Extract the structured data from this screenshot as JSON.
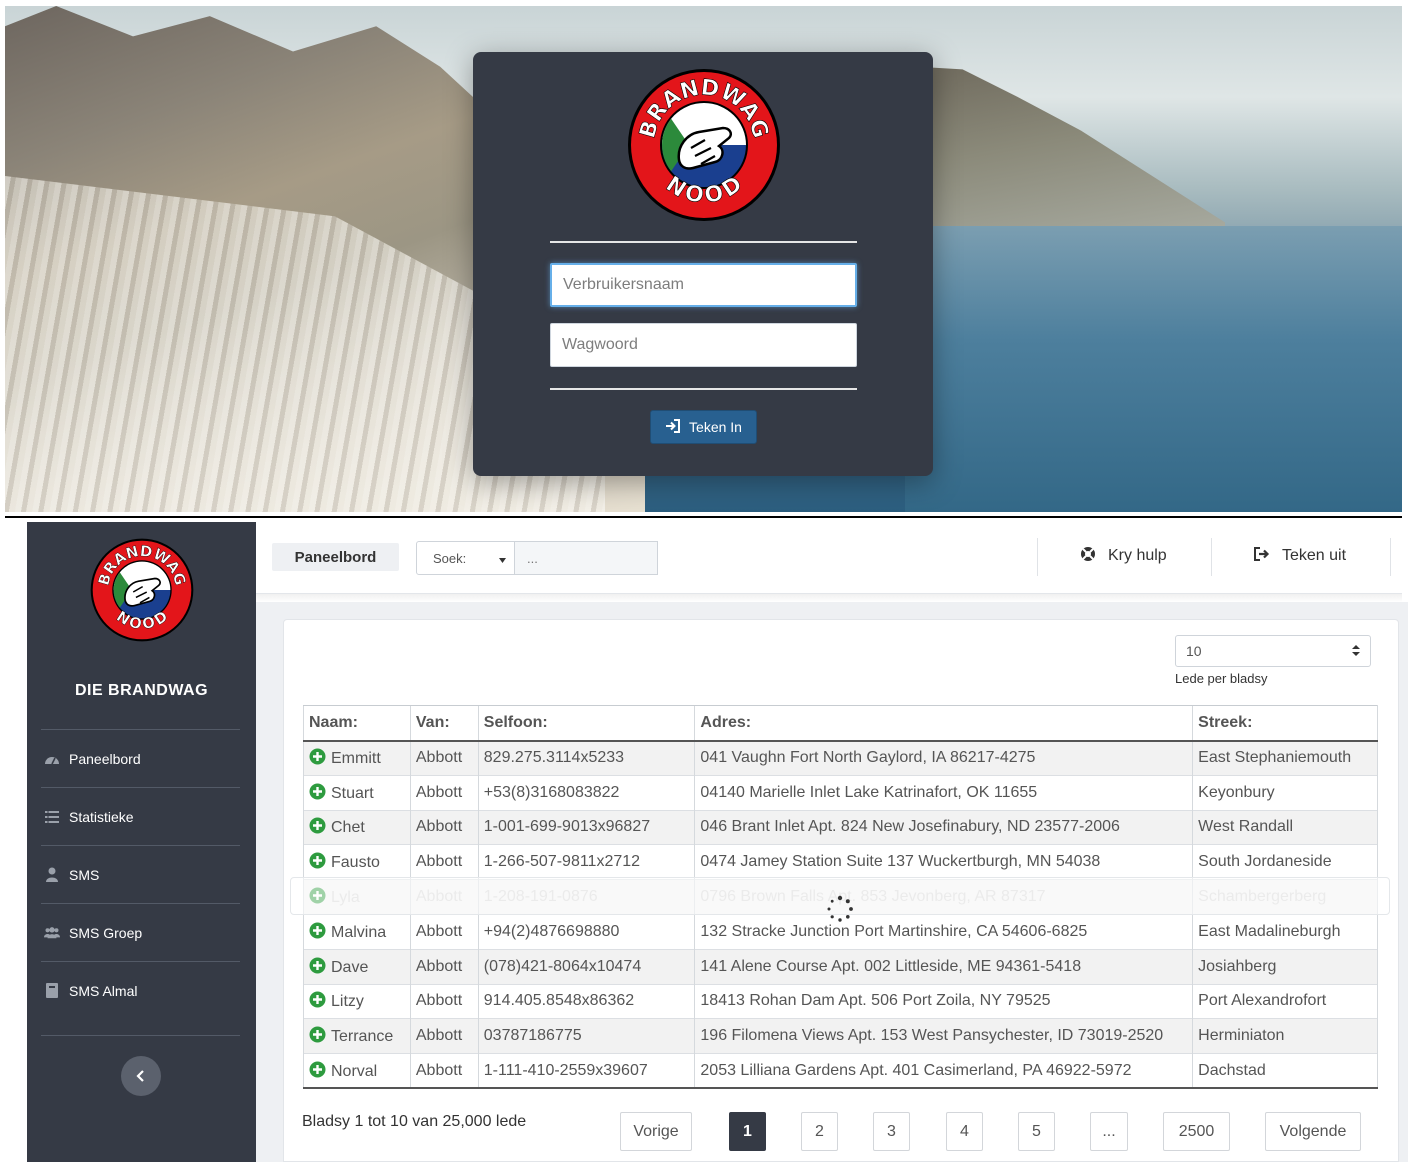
{
  "login": {
    "logo_top_text": "BRANDWAG",
    "logo_bottom_text": "NOOD",
    "username_placeholder": "Verbruikersnaam",
    "password_placeholder": "Wagwoord",
    "submit_label": "Teken In"
  },
  "sidebar": {
    "logo_top_text": "BRANDWAG",
    "logo_bottom_text": "NOOD",
    "title": "DIE BRANDWAG",
    "items": [
      {
        "label": "Paneelbord",
        "icon": "dashboard-icon"
      },
      {
        "label": "Statistieke",
        "icon": "list-icon"
      },
      {
        "label": "SMS",
        "icon": "user-icon"
      },
      {
        "label": "SMS Groep",
        "icon": "users-icon"
      },
      {
        "label": "SMS Almal",
        "icon": "book-icon"
      }
    ],
    "collapse_icon": "chevron-left-icon"
  },
  "topbar": {
    "breadcrumb": "Paneelbord",
    "search_select": "Soek:",
    "search_placeholder": "...",
    "help_label": "Kry hulp",
    "logout_label": "Teken uit"
  },
  "table_controls": {
    "page_size": "10",
    "page_size_label": "Lede per bladsy"
  },
  "table": {
    "headers": [
      "Naam:",
      "Van:",
      "Selfoon:",
      "Adres:",
      "Streek:"
    ],
    "rows": [
      [
        "Emmitt",
        "Abbott",
        "829.275.3114x5233",
        "041 Vaughn Fort North Gaylord, IA 86217-4275",
        "East Stephaniemouth"
      ],
      [
        "Stuart",
        "Abbott",
        "+53(8)3168083822",
        "04140 Marielle Inlet Lake Katrinafort, OK 11655",
        "Keyonbury"
      ],
      [
        "Chet",
        "Abbott",
        "1-001-699-9013x96827",
        "046 Brant Inlet Apt. 824 New Josefinabury, ND 23577-2006",
        "West Randall"
      ],
      [
        "Fausto",
        "Abbott",
        "1-266-507-9811x2712",
        "0474 Jamey Station Suite 137 Wuckertburgh, MN 54038",
        "South Jordaneside"
      ],
      [
        "Lyla",
        "Abbott",
        "1-208-191-0876",
        "0796 Brown Falls Apt. 853 Jevonberg, AR 87317",
        "Schambergerberg"
      ],
      [
        "Malvina",
        "Abbott",
        "+94(2)4876698880",
        "132 Stracke Junction Port Martinshire, CA 54606-6825",
        "East Madalineburgh"
      ],
      [
        "Dave",
        "Abbott",
        "(078)421-8064x10474",
        "141 Alene Course Apt. 002 Littleside, ME 94361-5418",
        "Josiahberg"
      ],
      [
        "Litzy",
        "Abbott",
        "914.405.8548x86362",
        "18413 Rohan Dam Apt. 506 Port Zoila, NY 79525",
        "Port Alexandrofort"
      ],
      [
        "Terrance",
        "Abbott",
        "03787186775",
        "196 Filomena Views Apt. 153 West Pansychester, ID 73019-2520",
        "Herminiaton"
      ],
      [
        "Norval",
        "Abbott",
        "1-111-410-2559x39607",
        "2053 Lilliana Gardens Apt. 401 Casimerland, PA 46922-5972",
        "Dachstad"
      ]
    ]
  },
  "pagination": {
    "info": "Bladsy 1 tot 10 van 25,000 lede",
    "prev": "Vorige",
    "pages": [
      "1",
      "2",
      "3",
      "4",
      "5",
      "...",
      "2500"
    ],
    "active_page": "1",
    "next": "Volgende"
  },
  "colors": {
    "panel_dark": "#353a45",
    "primary_button": "#286090",
    "logo_red": "#e3151a",
    "add_icon_green": "#2e9b3f"
  }
}
